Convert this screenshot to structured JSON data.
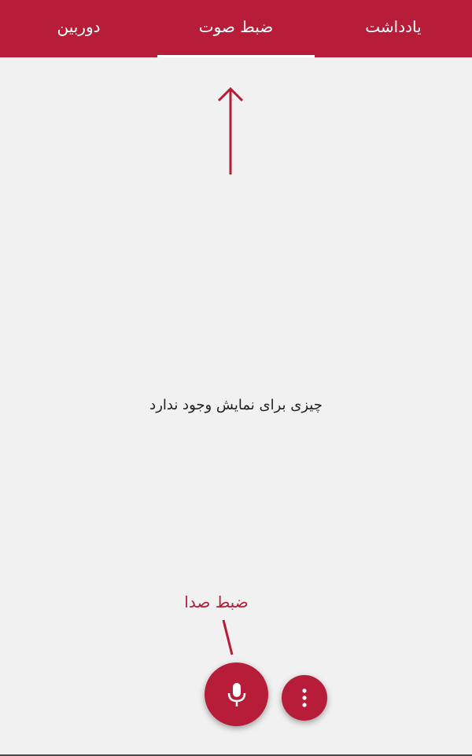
{
  "tabs": [
    {
      "label": "دوربین",
      "selected": false
    },
    {
      "label": "ضبط صوت",
      "selected": true
    },
    {
      "label": "یادداشت",
      "selected": false
    }
  ],
  "main": {
    "empty_message": "چیزی برای نمایش وجود ندارد"
  },
  "hint": {
    "label": "ضبط صدا"
  },
  "fab": {
    "record_icon": "microphone-icon",
    "more_icon": "more-vertical-icon"
  },
  "colors": {
    "accent": "#b71c38",
    "background": "#f1f1f1",
    "text": "#212121"
  }
}
